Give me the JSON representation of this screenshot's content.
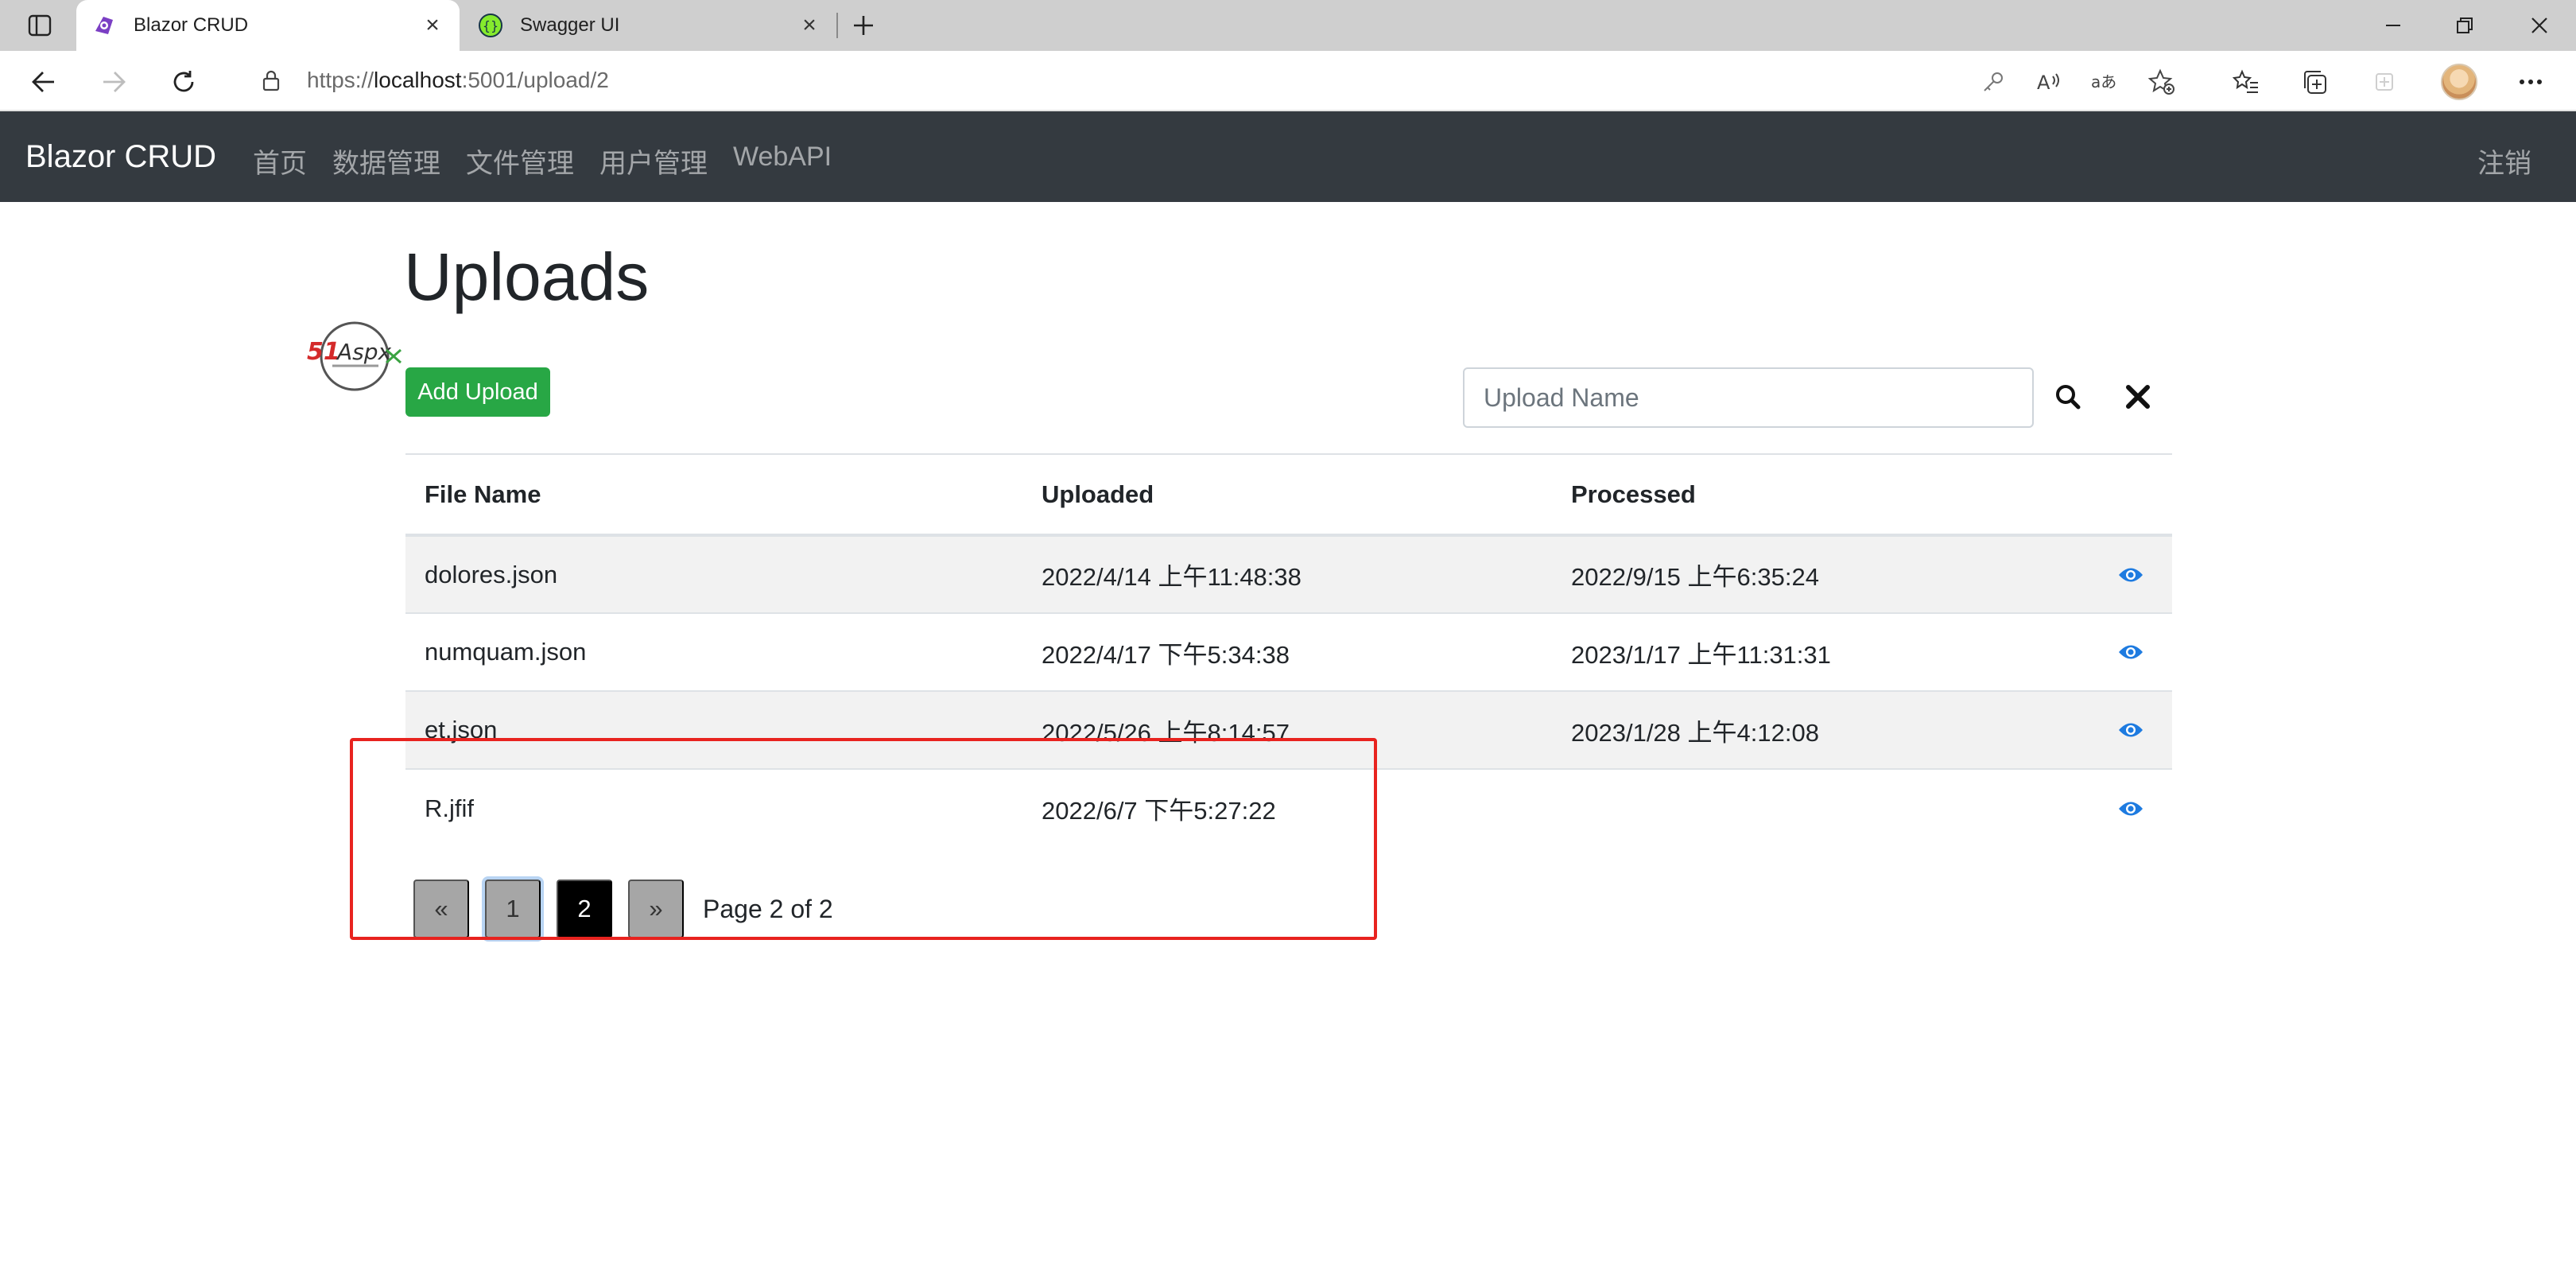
{
  "browser": {
    "tabs": [
      {
        "title": "Blazor CRUD",
        "icon": "blazor-icon",
        "active": true
      },
      {
        "title": "Swagger UI",
        "icon": "swagger-icon",
        "active": false
      }
    ],
    "url": {
      "prefix": "https://",
      "host": "localhost",
      "rest": ":5001/upload/2"
    }
  },
  "app": {
    "brand": "Blazor CRUD",
    "nav": [
      "首页",
      "数据管理",
      "文件管理",
      "用户管理",
      "WebAPI"
    ],
    "logout": "注销",
    "colors": {
      "navbar": "#343a40",
      "success": "#28a745",
      "link": "#1e7be0",
      "highlight": "#e8231f"
    }
  },
  "page": {
    "title": "Uploads",
    "add_button": "Add Upload",
    "search_placeholder": "Upload Name",
    "table": {
      "headers": [
        "File Name",
        "Uploaded",
        "Processed"
      ],
      "rows": [
        {
          "file": "dolores.json",
          "uploaded": "2022/4/14 上午11:48:38",
          "processed": "2022/9/15 上午6:35:24"
        },
        {
          "file": "numquam.json",
          "uploaded": "2022/4/17 下午5:34:38",
          "processed": "2023/1/17 上午11:31:31"
        },
        {
          "file": "et.json",
          "uploaded": "2022/5/26 上午8:14:57",
          "processed": "2023/1/28 上午4:12:08"
        },
        {
          "file": "R.jfif",
          "uploaded": "2022/6/7 下午5:27:22",
          "processed": ""
        }
      ]
    },
    "pagination": {
      "prev": "«",
      "pages": [
        "1",
        "2"
      ],
      "current": "2",
      "next": "»",
      "info": "Page 2 of 2"
    }
  }
}
